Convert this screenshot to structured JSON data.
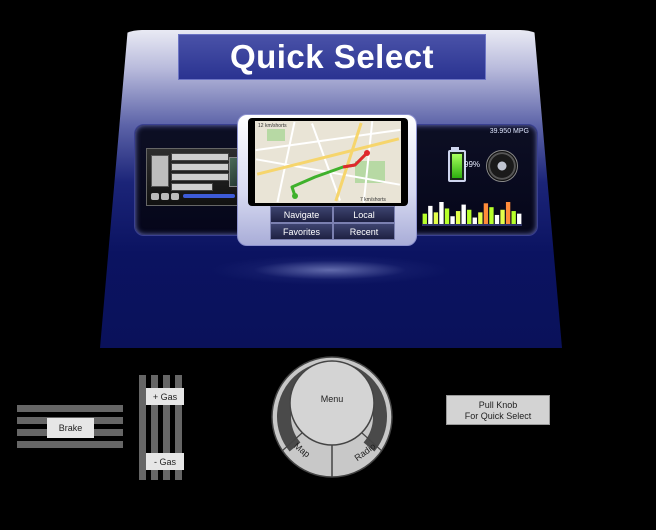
{
  "title": "Quick Select",
  "map": {
    "top_label": "12 km/shorts",
    "bottom_label": "7 km/shorts"
  },
  "quick_buttons": {
    "navigate": "Navigate",
    "local": "Local",
    "favorites": "Favorites",
    "recent": "Recent"
  },
  "energy": {
    "mpg_label": "39.950 MPG",
    "battery_pct": "99%",
    "battery_level": 0.99,
    "bars": [
      8,
      14,
      9,
      17,
      12,
      6,
      10,
      15,
      11,
      5,
      9,
      16,
      13,
      7,
      11,
      17,
      10,
      8
    ],
    "bar_colors": [
      "#b7ff2b",
      "#ffffff",
      "#e4ff4a",
      "#ffffff",
      "#b7ff2b",
      "#ffffff",
      "#e4ff4a",
      "#ffffff",
      "#b7ff2b",
      "#ffffff",
      "#e4ff4a",
      "#ff8c3a",
      "#b7ff2b",
      "#ffffff",
      "#e4ff4a",
      "#ff8c3a",
      "#b7ff2b",
      "#ffffff"
    ]
  },
  "controls": {
    "brake": "Brake",
    "gas_up": "+ Gas",
    "gas_down": "- Gas",
    "knob_center": "Menu",
    "knob_left": "Map",
    "knob_right": "Radio",
    "pull_knob_line1": "Pull Knob",
    "pull_knob_line2": "For Quick Select"
  },
  "colors": {
    "console_dark": "#0a115a",
    "route_red": "#e0282c",
    "route_green": "#3fb12c"
  }
}
